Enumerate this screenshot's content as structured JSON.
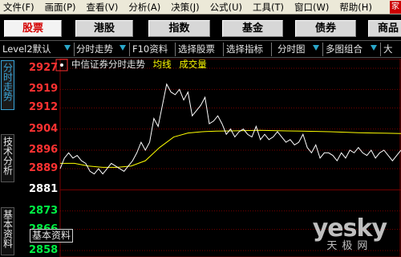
{
  "menubar": {
    "items": [
      "文件(F)",
      "画面(P)",
      "查看(V)",
      "分析(A)",
      "决策(J)",
      "公式(U)",
      "工具(T)",
      "窗口(W)",
      "帮助(H)"
    ],
    "logo": "家"
  },
  "quicktabs": [
    "股票",
    "港股",
    "指数",
    "基金",
    "债券",
    "商品"
  ],
  "toolbar": {
    "items": [
      "Level2默认",
      "分时走势",
      "F10资料",
      "选择股票",
      "选择指标",
      "分时图",
      "多图组合",
      "大"
    ]
  },
  "sidetabs": [
    "分时走势",
    "技术分析",
    "基本资料"
  ],
  "chart": {
    "legend_title": "中信证券分时走势",
    "legend_ma": "均线",
    "legend_vol": "成交量",
    "info_box": "基本资料",
    "price_labels": [
      {
        "value": "2927",
        "trend": "up"
      },
      {
        "value": "2919",
        "trend": "up"
      },
      {
        "value": "2912",
        "trend": "up"
      },
      {
        "value": "2904",
        "trend": "up"
      },
      {
        "value": "2896",
        "trend": "up"
      },
      {
        "value": "2889",
        "trend": "up"
      },
      {
        "value": "2881",
        "trend": "flat"
      },
      {
        "value": "2873",
        "trend": "down"
      },
      {
        "value": "2866",
        "trend": "down"
      },
      {
        "value": "2858",
        "trend": "down"
      }
    ]
  },
  "chart_data": {
    "type": "line",
    "title": "中信证券分时走势",
    "ylabel": "",
    "xlabel": "",
    "ylim": [
      2858,
      2927
    ],
    "yticks": [
      2927,
      2919,
      2912,
      2904,
      2896,
      2889,
      2881,
      2873,
      2866,
      2858
    ],
    "series": [
      {
        "name": "分时走势",
        "color": "#ffffff",
        "x": [
          0,
          3,
          6,
          9,
          12,
          15,
          18,
          21,
          24,
          27,
          30,
          33,
          36,
          39,
          42,
          45,
          48,
          51,
          54,
          57,
          60,
          63,
          66,
          69,
          72,
          75,
          78,
          81,
          84,
          87,
          90,
          93,
          96,
          99,
          102,
          105,
          108,
          111,
          114,
          117,
          120,
          123,
          126,
          129,
          132,
          135,
          138,
          141,
          144,
          147,
          150,
          153,
          156,
          159,
          162,
          165,
          168,
          171,
          174,
          177,
          180,
          183,
          186,
          189,
          192,
          195,
          198,
          201,
          204,
          207,
          210,
          213,
          216,
          219,
          222,
          225,
          228,
          231,
          234,
          237,
          240
        ],
        "values": [
          2889,
          2893,
          2895,
          2893,
          2894,
          2892,
          2891,
          2888,
          2887,
          2889,
          2887,
          2889,
          2891,
          2890,
          2889,
          2888,
          2890,
          2892,
          2895,
          2899,
          2896,
          2899,
          2908,
          2905,
          2913,
          2921,
          2918,
          2917,
          2919,
          2915,
          2918,
          2909,
          2911,
          2913,
          2916,
          2906,
          2907,
          2909,
          2906,
          2902,
          2904,
          2901,
          2903,
          2904,
          2902,
          2901,
          2905,
          2900,
          2902,
          2900,
          2901,
          2903,
          2901,
          2899,
          2900,
          2898,
          2899,
          2902,
          2897,
          2895,
          2898,
          2893,
          2895,
          2895,
          2894,
          2892,
          2895,
          2893,
          2896,
          2895,
          2897,
          2895,
          2894,
          2896,
          2893,
          2895,
          2896,
          2894,
          2892,
          2894,
          2896
        ]
      },
      {
        "name": "均线",
        "color": "#ffff00",
        "x": [
          0,
          10,
          20,
          30,
          40,
          50,
          60,
          70,
          80,
          90,
          100,
          110,
          120,
          130,
          140,
          150,
          160,
          170,
          180,
          190,
          200,
          210,
          220,
          230,
          240
        ],
        "values": [
          2891,
          2891,
          2890,
          2889.5,
          2889.5,
          2890,
          2892,
          2897,
          2901,
          2902.5,
          2903,
          2903.2,
          2903.3,
          2903.4,
          2903.5,
          2903.4,
          2903.3,
          2903.2,
          2903.1,
          2903,
          2902.8,
          2902.6,
          2902.5,
          2902.4,
          2902.3
        ]
      }
    ]
  },
  "colors": {
    "up": "#ff3232",
    "down": "#00ee44",
    "flat": "#ffffff",
    "grid": "#7a0000",
    "price_line": "#ffffff",
    "avg_line": "#ffff00",
    "active_tab": "#d40000",
    "toolbar_arrow": "#2aa7c9",
    "sidetab_active": "#3aa4d8"
  }
}
